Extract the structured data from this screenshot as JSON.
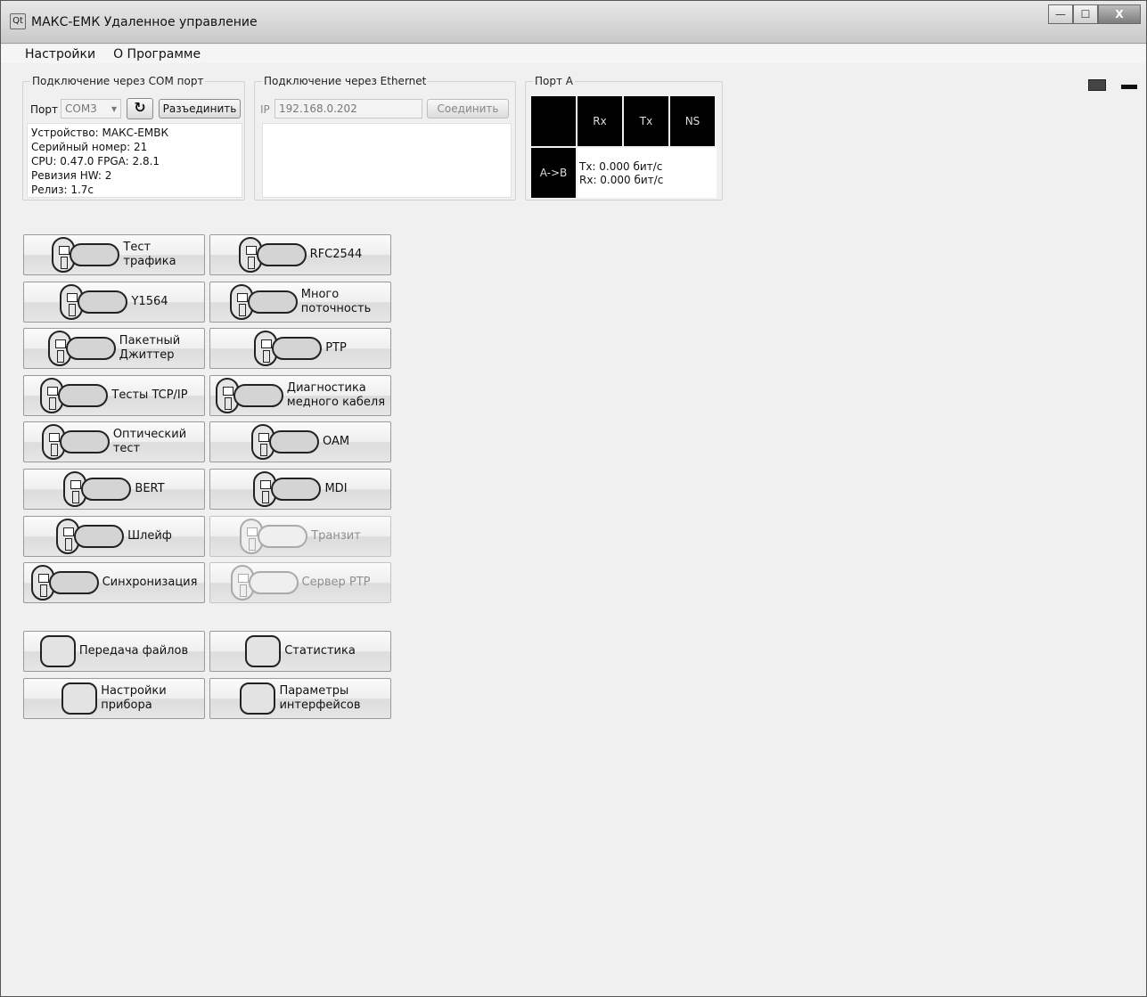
{
  "window": {
    "title": "МАКС-ЕМК Удаленное управление",
    "icon_text": "Qt",
    "controls": {
      "minimize": "—",
      "maximize": "☐",
      "close": "X"
    }
  },
  "menu": [
    "Настройки",
    "О Программе"
  ],
  "com": {
    "group_title": "Подключение через COM порт",
    "port_label": "Порт",
    "port_value": "COM3",
    "refresh_icon": "refresh-icon",
    "disconnect_label": "Разъединить",
    "info": [
      "Устройство: МАКС-ЕМВК",
      "Серийный номер: 21",
      "CPU: 0.47.0 FPGA: 2.8.1",
      "Ревизия HW: 2",
      "Релиз: 1.7с"
    ]
  },
  "ethernet": {
    "group_title": "Подключение через Ethernet",
    "ip_label": "IP",
    "ip_value": "192.168.0.202",
    "connect_label": "Соединить"
  },
  "port_a": {
    "group_title": "Порт А",
    "headers": [
      "",
      "Rx",
      "Tx",
      "NS"
    ],
    "row_label": "A->B",
    "tx": "Tx: 0.000 бит/с",
    "rx": "Rx: 0.000 бит/с"
  },
  "tests": [
    {
      "label": "Тест\nтрафика",
      "enabled": true,
      "icon": "traffic-test-icon"
    },
    {
      "label": "RFC2544",
      "enabled": true,
      "icon": "rfc2544-icon"
    },
    {
      "label": "Y1564",
      "enabled": true,
      "icon": "y1564-icon"
    },
    {
      "label": "Много\nпоточность",
      "enabled": true,
      "icon": "multistream-icon"
    },
    {
      "label": "Пакетный\nДжиттер",
      "enabled": true,
      "icon": "packet-jitter-icon"
    },
    {
      "label": "PTP",
      "enabled": true,
      "icon": "ptp-icon"
    },
    {
      "label": "Тесты TCP/IP",
      "enabled": true,
      "icon": "tcpip-tests-icon"
    },
    {
      "label": "Диагностика\nмедного кабеля",
      "enabled": true,
      "icon": "copper-cable-icon"
    },
    {
      "label": "Оптический\nтест",
      "enabled": true,
      "icon": "optical-test-icon"
    },
    {
      "label": "OAM",
      "enabled": true,
      "icon": "oam-icon"
    },
    {
      "label": "BERT",
      "enabled": true,
      "icon": "bert-icon"
    },
    {
      "label": "MDI",
      "enabled": true,
      "icon": "mdi-icon"
    },
    {
      "label": "Шлейф",
      "enabled": true,
      "icon": "loopback-icon"
    },
    {
      "label": "Транзит",
      "enabled": false,
      "icon": "transit-icon"
    },
    {
      "label": "Синхронизация",
      "enabled": true,
      "icon": "sync-icon"
    },
    {
      "label": "Сервер PTP",
      "enabled": false,
      "icon": "ptp-server-icon"
    }
  ],
  "tools": [
    {
      "label": "Передача файлов",
      "icon": "file-transfer-icon"
    },
    {
      "label": "Статистика",
      "icon": "statistics-icon"
    },
    {
      "label": "Настройки\nприбора",
      "icon": "device-settings-icon"
    },
    {
      "label": "Параметры\nинтерфейсов",
      "icon": "interface-params-icon"
    }
  ],
  "lang_icons": [
    "uk-flag-icon",
    "dash-icon"
  ]
}
